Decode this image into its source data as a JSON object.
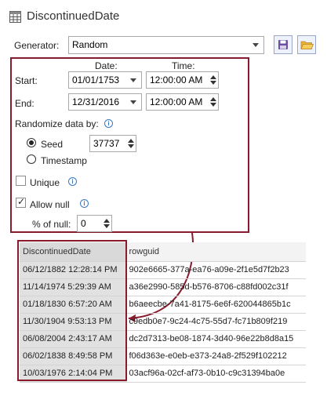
{
  "title": "DiscontinuedDate",
  "generator": {
    "label": "Generator:",
    "value": "Random"
  },
  "columns": {
    "date": "Date:",
    "time": "Time:"
  },
  "start": {
    "label": "Start:",
    "date": "01/01/1753",
    "time": "12:00:00 AM"
  },
  "end": {
    "label": "End:",
    "date": "12/31/2016",
    "time": "12:00:00 AM"
  },
  "randomize": {
    "label": "Randomize data by:",
    "seed_label": "Seed",
    "seed_value": "37737",
    "timestamp_label": "Timestamp"
  },
  "unique": {
    "label": "Unique"
  },
  "allow_null": {
    "label": "Allow null",
    "pct_label": "% of null:",
    "pct_value": "0"
  },
  "grid": {
    "headers": [
      "DiscontinuedDate",
      "rowguid"
    ],
    "rows": [
      [
        "06/12/1882 12:28:14 PM",
        "902e6665-377a-ea76-a09e-2f1e5d7f2b23"
      ],
      [
        "11/14/1974 5:29:39 AM",
        "a36e2990-585d-b576-8706-c88fd002c31f"
      ],
      [
        "01/18/1830 6:57:20 AM",
        "b6aeecbe-7a41-8175-6e6f-620044865b1c"
      ],
      [
        "11/30/1904 9:53:13 PM",
        "c9edb0e7-9c24-4c75-55d7-fc71b809f219"
      ],
      [
        "06/08/2004 2:43:17 AM",
        "dc2d7313-be08-1874-3d40-96e22b8d8a15"
      ],
      [
        "06/02/1838 8:49:58 PM",
        "f06d363e-e0eb-e373-24a8-2f529f102212"
      ],
      [
        "10/03/1976 2:14:04 PM",
        "03acf96a-02cf-af73-0b10-c9c31394ba0e"
      ]
    ]
  },
  "colors": {
    "frame": "#8a1a2e",
    "info": "#3a78c2"
  }
}
